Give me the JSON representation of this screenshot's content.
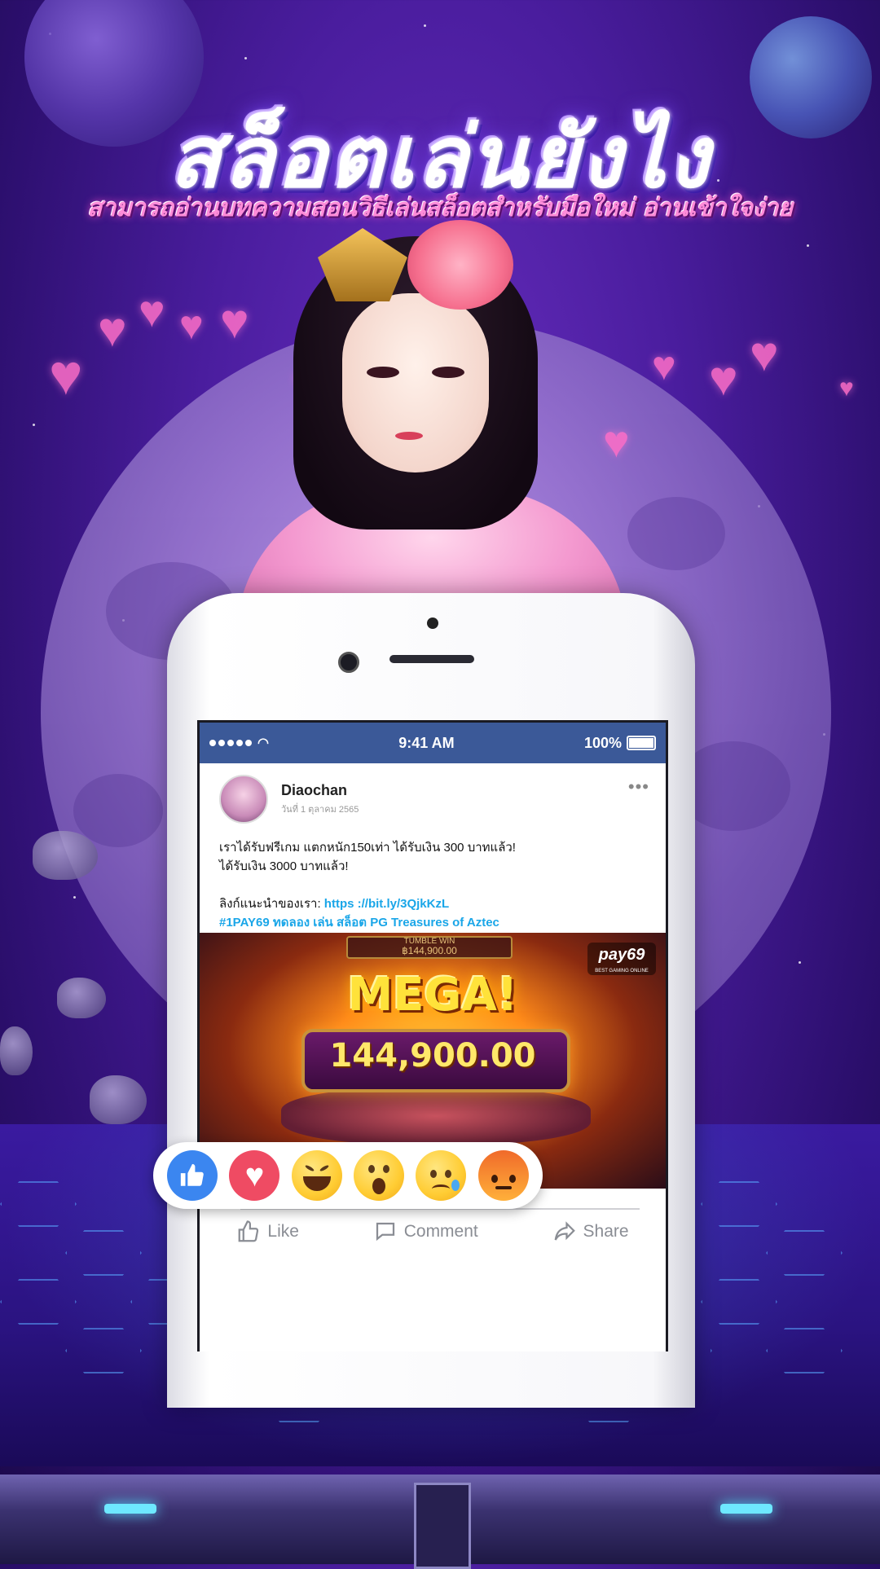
{
  "banner": {
    "title": "สล็อตเล่นยังไง",
    "subtitle": "สามารถอ่านบทความสอนวิธีเล่นสล็อตสำหรับมือใหม่ อ่านเข้าใจง่าย"
  },
  "phone": {
    "status_bar": {
      "time": "9:41 AM",
      "battery": "100%"
    },
    "post": {
      "author": "Diaochan",
      "date": "วันที่ 1 ตุลาคม 2565",
      "more_label": "•••",
      "text_line1": "เราได้รับฟรีเกม แตกหนัก150เท่า ได้รับเงิน 300 บาทแล้ว!",
      "text_line2": "ได้รับเงิน 3000 บาทแล้ว!",
      "link_label": "ลิงก์แนะนำของเรา: ",
      "link_url": "https ://bit.ly/3QjkKzL",
      "hashtag": "#1PAY69 ทดลอง เล่น สล็อต PG Treasures of Aztec"
    },
    "game_image": {
      "top_label": "TUMBLE WIN",
      "top_value": "฿144,900.00",
      "headline": "MEGA!",
      "amount": "144,900.00",
      "logo": "pay69",
      "logo_tagline": "BEST GAMING ONLINE"
    },
    "actions": {
      "like": "Like",
      "comment": "Comment",
      "share": "Share"
    }
  },
  "reactions": [
    "like-icon",
    "love-icon",
    "haha-icon",
    "wow-icon",
    "sad-icon",
    "angry-icon"
  ],
  "colors": {
    "facebook_blue": "#3b5998",
    "link": "#1aa6e8",
    "background": "#4a1d9e"
  }
}
